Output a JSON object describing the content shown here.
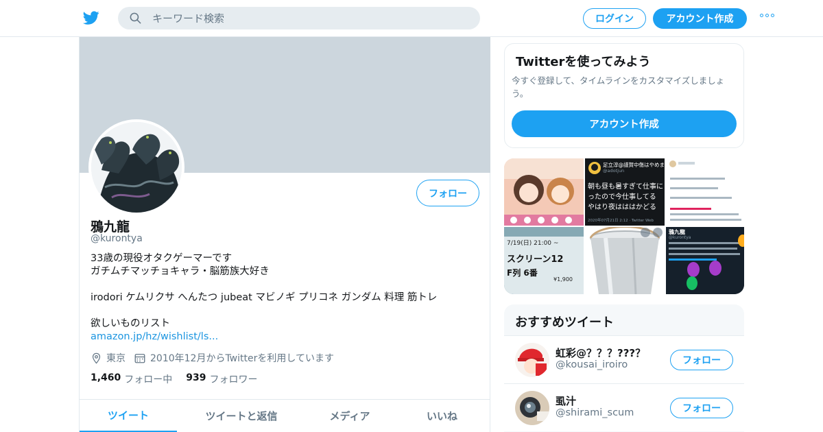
{
  "header": {
    "logo_icon": "twitter-bird-icon",
    "search_placeholder": "キーワード検索",
    "login_label": "ログイン",
    "signup_label": "アカウント作成",
    "more_icon": "more-dots-icon",
    "accent_color": "#1da1f2"
  },
  "profile": {
    "name": "鴉九龍",
    "handle": "@kurontya",
    "follow_label": "フォロー",
    "bio_line1": "33歳の現役オタクゲーマーです",
    "bio_line2": "ガチムチマッチョキャラ・脳筋族大好き",
    "bio_line3": "irodori ケムリクサ へんたつ jubeat マビノギ プリコネ ガンダム 料理 筋トレ",
    "bio_line4": "欲しいものリスト",
    "bio_link": "amazon.jp/hz/wishlist/ls...",
    "location": "東京",
    "joined": "2010年12月からTwitterを利用しています",
    "following_count": "1,460",
    "following_label": "フォロー中",
    "followers_count": "939",
    "followers_label": "フォロワー",
    "tabs": [
      {
        "label": "ツイート"
      },
      {
        "label": "ツイートと返信"
      },
      {
        "label": "メディア"
      },
      {
        "label": "いいね"
      }
    ]
  },
  "signup_card": {
    "title": "Twitterを使ってみよう",
    "description": "今すぐ登録して、タイムラインをカスタマイズしましょう。",
    "cta_label": "アカウント作成"
  },
  "media_thumbs": {
    "t2_name": "足立淳@謹賀中傷はやめま",
    "t2_handle": "@adotjun",
    "t2_line1": "朝も昼も暑すぎて仕事に",
    "t2_line2": "ったので今仕事してる",
    "t2_line3": "やはり夜はははかどる",
    "t2_date": "2020年07月21日 2:12 · Twitter Web",
    "t4_line1": "7/19(日) 21:00 ~",
    "t4_line2": "スクリーン12",
    "t4_line3": "F列 6番",
    "t4_price": "¥1,900",
    "t6_name": "鴉九龍",
    "t6_handle": "@kurontya"
  },
  "recommended": {
    "title": "おすすめツイート",
    "users": [
      {
        "name": "虹彩@？？？???？",
        "handle": "@kousai_iroiro",
        "follow_label": "フォロー"
      },
      {
        "name": "虱汁",
        "handle": "@shirami_scum",
        "follow_label": "フォロー"
      }
    ]
  }
}
